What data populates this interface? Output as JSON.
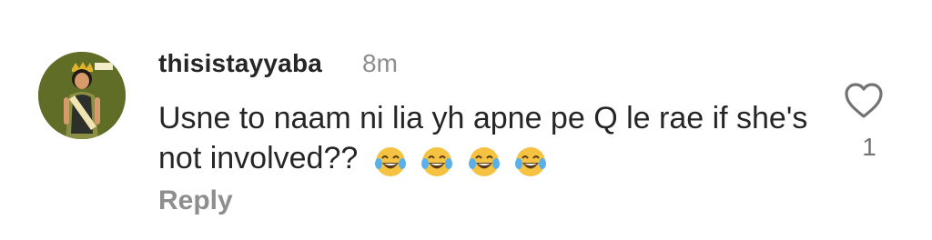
{
  "comment": {
    "username": "thisistayyaba",
    "timestamp": "8m",
    "text": "Usne to naam ni lia yh apne pe Q le rae if she's not involved??",
    "emojis": [
      "face-with-tears-of-joy",
      "face-with-tears-of-joy",
      "face-with-tears-of-joy",
      "face-with-tears-of-joy"
    ],
    "reply_label": "Reply",
    "like_icon": "heart-outline-icon",
    "like_count": "1"
  },
  "avatar": {
    "sticker_text": "Say no"
  },
  "colors": {
    "text_primary": "#262626",
    "text_secondary": "#8e8e8e",
    "avatar_bg": "#5f6d27"
  }
}
